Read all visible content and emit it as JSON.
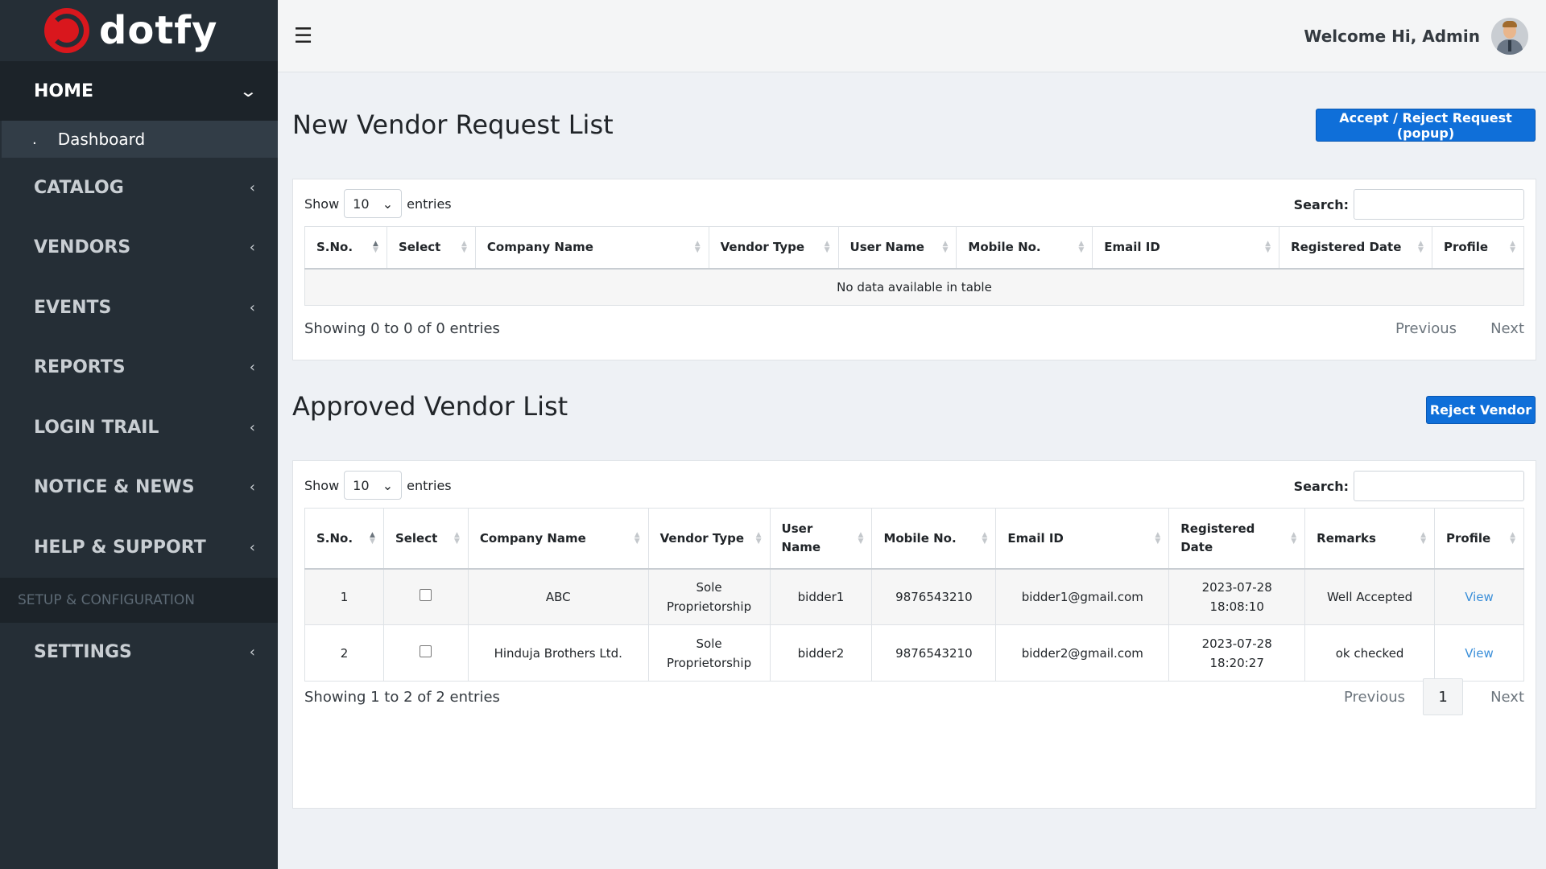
{
  "brand": {
    "name": "dotfy",
    "color": "#d9171d"
  },
  "sidebar": {
    "home_label": "HOME",
    "dashboard_label": "Dashboard",
    "items": [
      {
        "label": "CATALOG"
      },
      {
        "label": "VENDORS"
      },
      {
        "label": "EVENTS"
      },
      {
        "label": "REPORTS"
      },
      {
        "label": "LOGIN TRAIL"
      },
      {
        "label": "NOTICE & NEWS"
      },
      {
        "label": "HELP & SUPPORT"
      }
    ],
    "section_header": "SETUP & CONFIGURATION",
    "settings_label": "SETTINGS"
  },
  "topbar": {
    "welcome": "Welcome Hi, Admin"
  },
  "request_section": {
    "title": "New Vendor Request List",
    "action_button": "Accept / Reject Request (popup)",
    "show_label": "Show",
    "entries_value": "10",
    "entries_label": "entries",
    "search_label": "Search:",
    "columns": [
      "S.No.",
      "Select",
      "Company Name",
      "Vendor Type",
      "User Name",
      "Mobile No.",
      "Email ID",
      "Registered Date",
      "Profile"
    ],
    "empty_text": "No data available in table",
    "showing_text": "Showing 0 to 0 of 0 entries",
    "prev": "Previous",
    "next": "Next"
  },
  "approved_section": {
    "title": "Approved Vendor List",
    "action_button": "Reject Vendor",
    "show_label": "Show",
    "entries_value": "10",
    "entries_label": "entries",
    "search_label": "Search:",
    "columns": [
      "S.No.",
      "Select",
      "Company Name",
      "Vendor Type",
      "User Name",
      "Mobile No.",
      "Email ID",
      "Registered Date",
      "Remarks",
      "Profile"
    ],
    "rows": [
      {
        "sno": "1",
        "company": "ABC",
        "type_line1": "Sole",
        "type_line2": "Proprietorship",
        "user": "bidder1",
        "mobile": "9876543210",
        "email": "bidder1@gmail.com",
        "date": "2023-07-28",
        "time": "18:08:10",
        "remarks": "Well Accepted",
        "profile": "View"
      },
      {
        "sno": "2",
        "company": "Hinduja Brothers Ltd.",
        "type_line1": "Sole",
        "type_line2": "Proprietorship",
        "user": "bidder2",
        "mobile": "9876543210",
        "email": "bidder2@gmail.com",
        "date": "2023-07-28",
        "time": "18:20:27",
        "remarks": "ok checked",
        "profile": "View"
      }
    ],
    "showing_text": "Showing 1 to 2 of 2 entries",
    "prev": "Previous",
    "page": "1",
    "next": "Next"
  }
}
